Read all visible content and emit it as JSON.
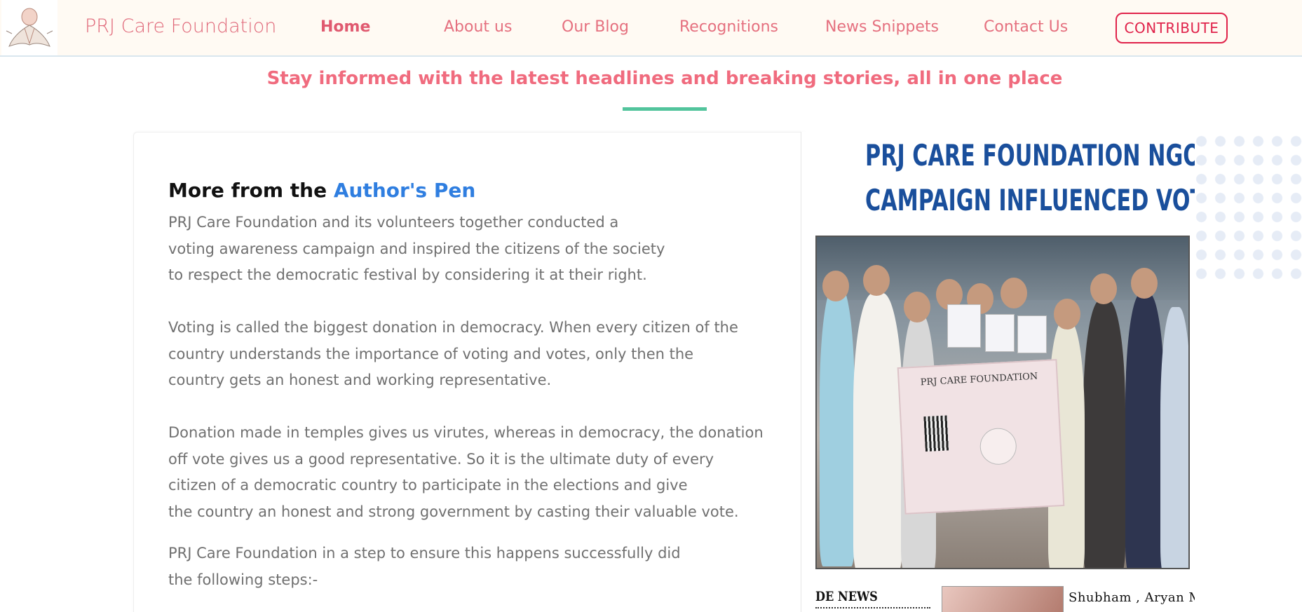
{
  "brand": {
    "name": "PRJ Care Foundation",
    "logo_icon": "angel-logo-icon"
  },
  "nav": {
    "items": [
      {
        "label": "Home",
        "active": true
      },
      {
        "label": "About us"
      },
      {
        "label": "Our Blog"
      },
      {
        "label": "Recognitions"
      },
      {
        "label": "News Snippets"
      },
      {
        "label": "Contact Us"
      }
    ],
    "cta": "CONTRIBUTE"
  },
  "section": {
    "tagline": "Stay informed with the latest headlines and breaking stories, all in one place"
  },
  "article": {
    "heading_prefix": "More from the ",
    "heading_accent": "Author's Pen",
    "paragraphs": [
      [
        "PRJ Care Foundation and its volunteers together conducted a",
        "voting awareness campaign and inspired the citizens of the society",
        "to respect the democratic festival by considering it at their right."
      ],
      [
        "Voting is called the biggest donation in democracy. When every citizen of the",
        "country understands the importance of voting and votes, only then the",
        "country gets an honest and working representative."
      ],
      [
        "Donation made in temples gives us virutes, whereas in democracy, the donation",
        "off vote gives us a good representative. So it is the ultimate duty of every",
        "citizen of a democratic country to participate in the elections and give",
        "the country an honest and strong government by casting their valuable vote."
      ],
      [
        "PRJ Care Foundation in a step to ensure this happens successfully did",
        "the following steps:-"
      ]
    ]
  },
  "clipping": {
    "headline_line1": "PRJ CARE FOUNDATION NGO VOTER AWARENESS",
    "headline_line2": "CAMPAIGN INFLUENCED VOTERS",
    "banner_text": "PRJ CARE FOUNDATION",
    "section_label": "DE NEWS",
    "caption": "Shubham , Aryan Mahajan,"
  },
  "colors": {
    "brand_pink": "#e0697a",
    "cta_red": "#e0224a",
    "accent_blue": "#2f7ee0",
    "underline_green": "#52c49c",
    "clip_blue": "#1a4f9c"
  }
}
